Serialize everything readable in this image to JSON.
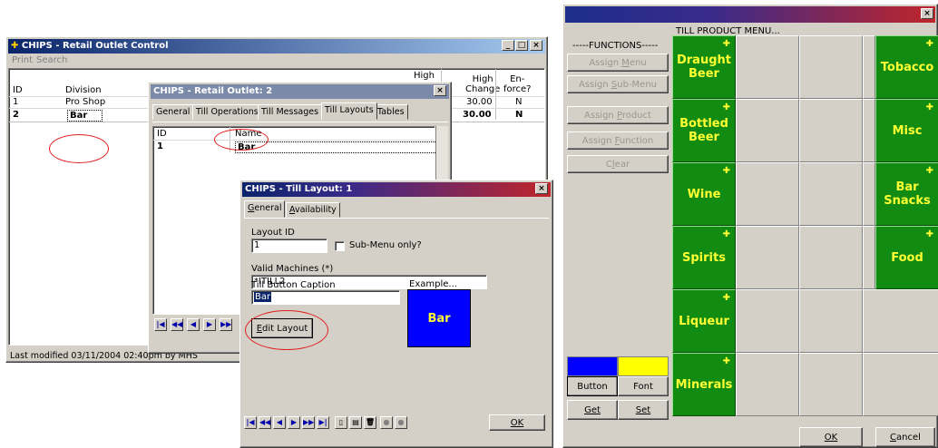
{
  "retail_control": {
    "title": "CHIPS - Retail Outlet Control",
    "menu": [
      "Print",
      "Search"
    ],
    "columns": {
      "id": "ID",
      "division": "Division",
      "high": "High",
      "high_change": "High\nChange",
      "enforce": "En-\nforce?"
    },
    "rows": [
      {
        "id": "1",
        "division": "Pro Shop",
        "high_change": "30.00",
        "enforce": "N"
      },
      {
        "id": "2",
        "division": "Bar",
        "high_change": "30.00",
        "enforce": "N"
      }
    ],
    "status": "Last modified 03/11/2004 02:40pm by MHS"
  },
  "outlet": {
    "title": "CHIPS - Retail Outlet: 2",
    "tabs": [
      "General",
      "Till Operations",
      "Till Messages",
      "Till Layouts",
      "Tables"
    ],
    "columns": {
      "id": "ID",
      "name": "Name"
    },
    "rows": [
      {
        "id": "1",
        "name": "Bar"
      }
    ]
  },
  "layout_dialog": {
    "title": "CHIPS - Till Layout: 1",
    "tabs": [
      "General",
      "Availability"
    ],
    "layout_id_label": "Layout ID",
    "layout_id_value": "1",
    "submenu_label": "Sub-Menu only?",
    "valid_machines_label": "Valid Machines (*)",
    "valid_machines_value": "*ITILL2",
    "caption_label": "Till Button Caption",
    "caption_value": "Bar",
    "example_label": "Example...",
    "example_text": "Bar",
    "edit_layout": "Edit Layout",
    "ok": "OK",
    "example_color": "#0000ff"
  },
  "till_menu": {
    "title": "TILL PRODUCT MENU...",
    "functions_label": "-----FUNCTIONS-----",
    "functions": [
      "Assign Menu",
      "Assign Sub-Menu",
      "Assign Product",
      "Assign Function",
      "Clear"
    ],
    "products": [
      "Draught\nBeer",
      "Bottled\nBeer",
      "Wine",
      "Spirits",
      "Liqueur",
      "Minerals"
    ],
    "right_products": [
      "Tobacco",
      "Misc",
      "Bar\nSnacks",
      "Food"
    ],
    "button_label": "Button",
    "font_label": "Font",
    "get_label": "Get",
    "set_label": "Set",
    "ok": "OK",
    "cancel": "Cancel",
    "button_swatch": "#0000ff",
    "font_swatch": "#ffff00",
    "product_color": "#118b11"
  }
}
